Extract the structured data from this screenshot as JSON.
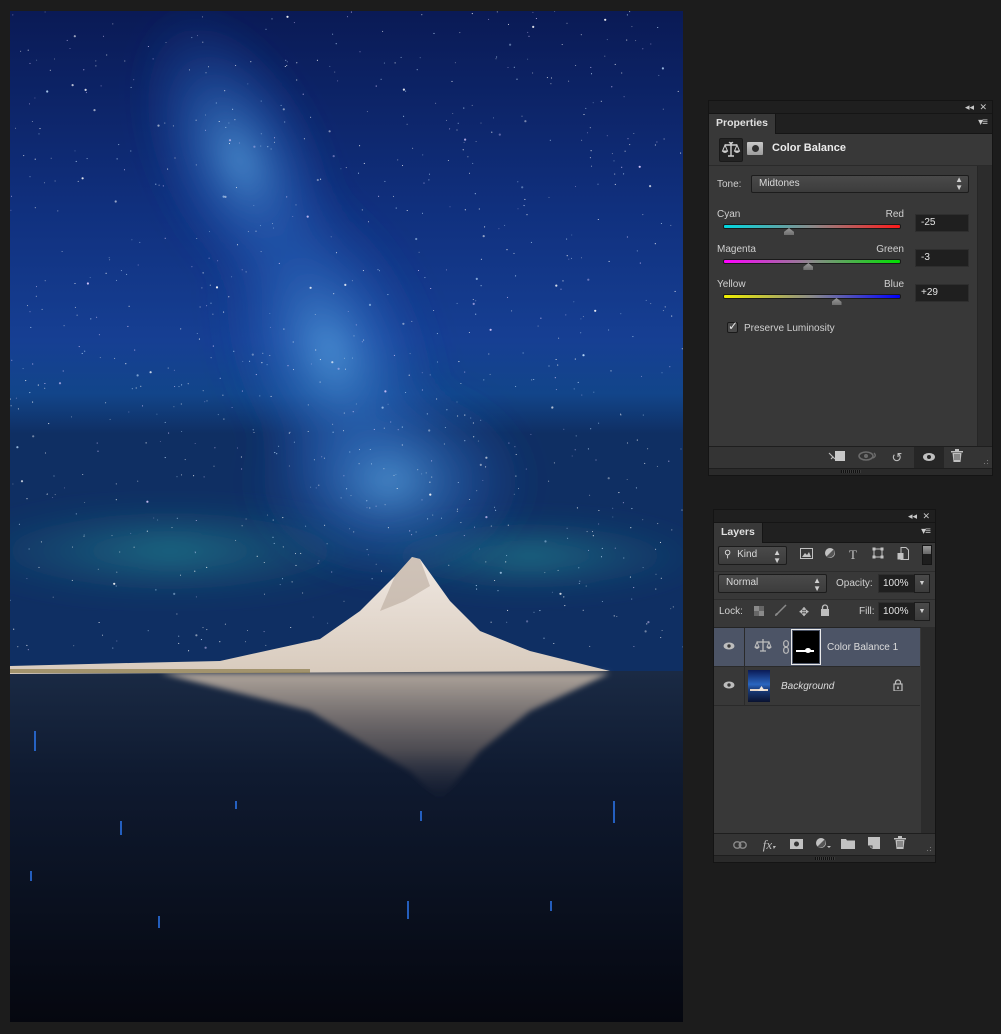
{
  "canvas": {
    "description": "Night photo: Milky Way over a snow-capped pointed mountain reflected in still water",
    "colors": {
      "sky_top": "#0b1a55",
      "sky_mid": "#1a4fa8",
      "milky_way": "#3a7fd0",
      "aurora": "#1f7c8a",
      "mountain_snow": "#e6dcd2",
      "water": "#0c1628"
    }
  },
  "properties_panel": {
    "tab_label": "Properties",
    "adjustment_title": "Color Balance",
    "tone_label": "Tone:",
    "tone_value": "Midtones",
    "sliders": [
      {
        "left_label": "Cyan",
        "right_label": "Red",
        "value": "-25",
        "numeric": -25,
        "min": -100,
        "max": 100,
        "left_color": "#00d8e0",
        "right_color": "#ff1a1a"
      },
      {
        "left_label": "Magenta",
        "right_label": "Green",
        "value": "-3",
        "numeric": -3,
        "min": -100,
        "max": 100,
        "left_color": "#ff00ff",
        "right_color": "#00e000"
      },
      {
        "left_label": "Yellow",
        "right_label": "Blue",
        "value": "+29",
        "numeric": 29,
        "min": -100,
        "max": 100,
        "left_color": "#f0f000",
        "right_color": "#0000ff"
      }
    ],
    "preserve_luminosity": {
      "label": "Preserve Luminosity",
      "checked": true
    },
    "footer_icons": [
      "clip-to-layer-icon",
      "view-previous-state-icon",
      "reset-icon",
      "visibility-icon",
      "delete-icon"
    ]
  },
  "layers_panel": {
    "tab_label": "Layers",
    "filter_kind": "Kind",
    "filter_icons": [
      "pixel-layer-filter-icon",
      "adjustment-layer-filter-icon",
      "type-layer-filter-icon",
      "shape-layer-filter-icon",
      "smart-object-filter-icon"
    ],
    "blend_mode": "Normal",
    "opacity_label": "Opacity:",
    "opacity_value": "100%",
    "lock_label": "Lock:",
    "fill_label": "Fill:",
    "fill_value": "100%",
    "layers": [
      {
        "name": "Color Balance 1",
        "type": "adjustment",
        "visible": true,
        "selected": true,
        "locked": false
      },
      {
        "name": "Background",
        "type": "pixel",
        "visible": true,
        "selected": false,
        "locked": true
      }
    ],
    "footer_icons": [
      "link-layers-icon",
      "fx-icon",
      "add-mask-icon",
      "new-adjustment-icon",
      "new-group-icon",
      "new-layer-icon",
      "delete-layer-icon"
    ],
    "footer_labels": {
      "fx": "fx"
    }
  },
  "glyphs": {
    "collapse": "◂◂",
    "close": "✕",
    "menu": "▾≡",
    "updown": "⬍",
    "down": "▼",
    "search": "⌕",
    "type": "T",
    "move": "✥",
    "lock": "🔒",
    "reset": "↺",
    "trash": "🗑",
    "link": "⛓"
  }
}
